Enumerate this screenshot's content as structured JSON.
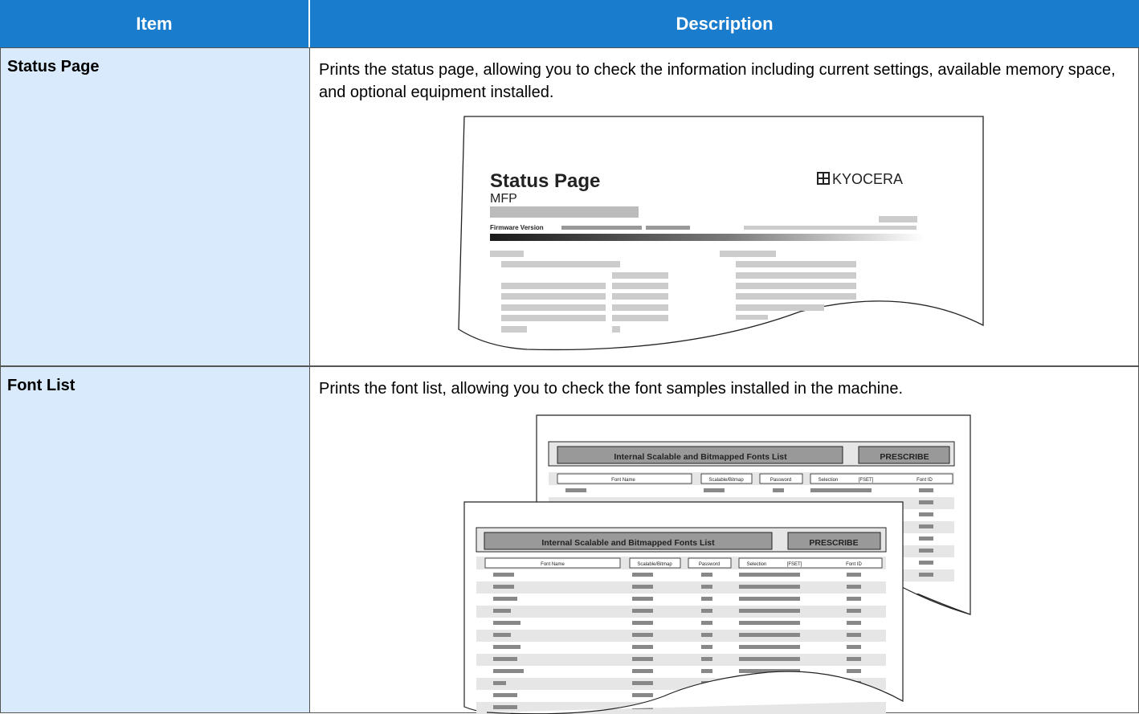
{
  "header": {
    "item": "Item",
    "description": "Description"
  },
  "rows": [
    {
      "item": "Status Page",
      "description": "Prints the status page, allowing you to check the information including current settings, available memory space, and optional equipment installed.",
      "illustration": {
        "title": "Status Page",
        "subtitle": "MFP",
        "firmware_label": "Firmware Version",
        "logo": "KYOCERA"
      }
    },
    {
      "item": "Font List",
      "description": "Prints the font list, allowing you to check the font samples installed in the machine.",
      "illustration": {
        "title": "Internal Scalable and Bitmapped Fonts List",
        "badge": "PRESCRIBE",
        "columns": [
          "Font Name",
          "Scalable/Bitmap",
          "Password",
          "Selection",
          "[FSET]",
          "Font ID"
        ]
      }
    }
  ]
}
